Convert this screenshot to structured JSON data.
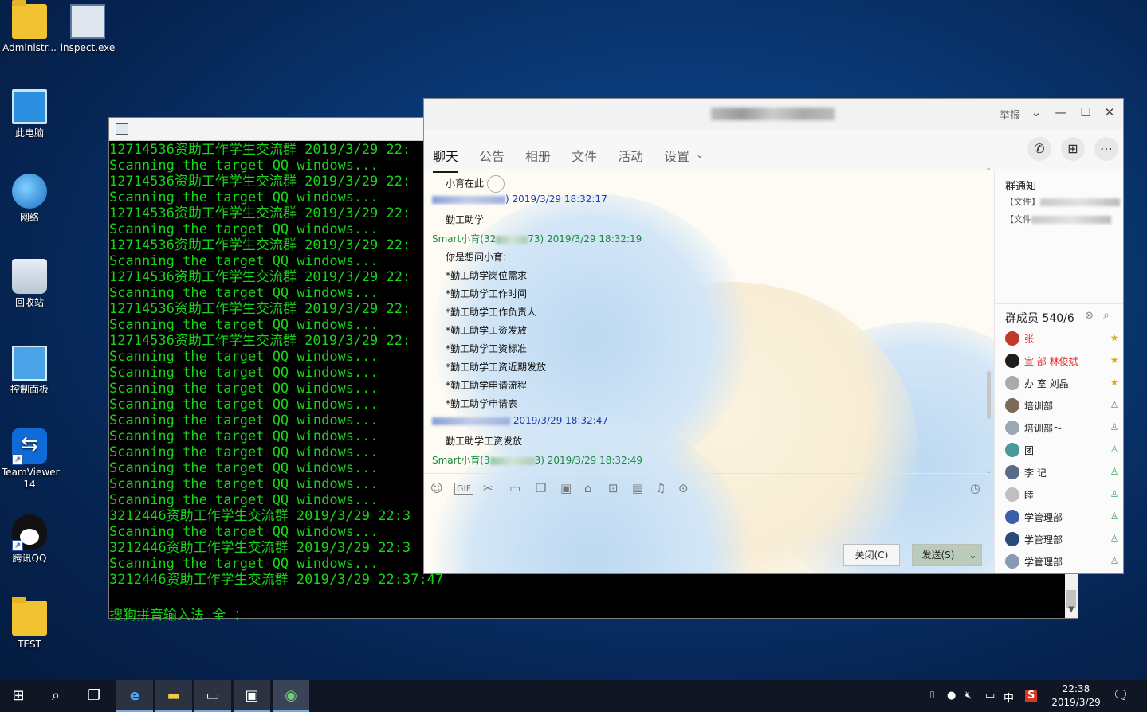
{
  "desktop": {
    "icons": [
      {
        "label": "Administr..."
      },
      {
        "label": "inspect.exe"
      },
      {
        "label": "此电脑"
      },
      {
        "label": "网络"
      },
      {
        "label": "回收站"
      },
      {
        "label": "控制面板"
      },
      {
        "label": "TeamViewer 14"
      },
      {
        "label": "腾讯QQ"
      },
      {
        "label": "TEST"
      }
    ]
  },
  "console": {
    "lines": [
      "12714536资助工作学生交流群 2019/3/29 22:",
      "Scanning the target QQ windows...",
      "12714536资助工作学生交流群 2019/3/29 22:",
      "Scanning the target QQ windows...",
      "12714536资助工作学生交流群 2019/3/29 22:",
      "Scanning the target QQ windows...",
      "12714536资助工作学生交流群 2019/3/29 22:",
      "Scanning the target QQ windows...",
      "12714536资助工作学生交流群 2019/3/29 22:",
      "Scanning the target QQ windows...",
      "12714536资助工作学生交流群 2019/3/29 22:",
      "Scanning the target QQ windows...",
      "12714536资助工作学生交流群 2019/3/29 22:",
      "Scanning the target QQ windows...",
      "Scanning the target QQ windows...",
      "Scanning the target QQ windows...",
      "Scanning the target QQ windows...",
      "Scanning the target QQ windows...",
      "Scanning the target QQ windows...",
      "Scanning the target QQ windows...",
      "Scanning the target QQ windows...",
      "Scanning the target QQ windows...",
      "Scanning the target QQ windows...",
      "3212446资助工作学生交流群 2019/3/29 22:3",
      "Scanning the target QQ windows...",
      "3212446资助工作学生交流群 2019/3/29 22:3",
      "Scanning the target QQ windows...",
      "3212446资助工作学生交流群 2019/3/29 22:37:47"
    ],
    "ime_status": "搜狗拼音输入法 全 ："
  },
  "qq": {
    "report": "举报",
    "tabs": [
      "聊天",
      "公告",
      "相册",
      "文件",
      "活动",
      "设置"
    ],
    "messages": [
      {
        "kind": "text",
        "text": "小育在此"
      },
      {
        "kind": "meta",
        "color": "blue",
        "prefix": "",
        "suffix": ") 2019/3/29 18:32:17"
      },
      {
        "kind": "text",
        "text": "勤工助学"
      },
      {
        "kind": "meta",
        "color": "green",
        "prefix": "Smart小育(32",
        "suffix": "73) 2019/3/29 18:32:19"
      },
      {
        "kind": "text",
        "text": "你是想问小育:"
      },
      {
        "kind": "text",
        "text": "*勤工助学岗位需求"
      },
      {
        "kind": "text",
        "text": "*勤工助学工作时间"
      },
      {
        "kind": "text",
        "text": "*勤工助学工作负责人"
      },
      {
        "kind": "text",
        "text": "*勤工助学工资发放"
      },
      {
        "kind": "text",
        "text": "*勤工助学工资标准"
      },
      {
        "kind": "text",
        "text": "*勤工助学工资近期发放"
      },
      {
        "kind": "text",
        "text": "*勤工助学申请流程"
      },
      {
        "kind": "text",
        "text": "*勤工助学申请表"
      },
      {
        "kind": "meta",
        "color": "blue",
        "prefix": "",
        "suffix": " 2019/3/29 18:32:47"
      },
      {
        "kind": "text",
        "text": "勤工助学工资发放"
      },
      {
        "kind": "meta",
        "color": "green",
        "prefix": "Smart小育(3",
        "suffix": "3) 2019/3/29 18:32:49"
      }
    ],
    "buttons": {
      "close": "关闭(C)",
      "send": "发送(S)"
    },
    "notice_title": "群通知",
    "notices": [
      "【文件】",
      "【文件"
    ],
    "members_title": "群成员 540/6",
    "members": [
      {
        "name": "张",
        "color": "#e02b2b"
      },
      {
        "name": "宣    部 林俊斌",
        "color": "#e02b2b"
      },
      {
        "name": "办   室 刘晶",
        "color": "#222222"
      },
      {
        "name": "培训部",
        "color": "#222222"
      },
      {
        "name": "培训部～",
        "color": "#222222"
      },
      {
        "name": "团",
        "color": "#222222"
      },
      {
        "name": "李   记",
        "color": "#222222"
      },
      {
        "name": "睦",
        "color": "#222222"
      },
      {
        "name": "学管理部",
        "color": "#222222"
      },
      {
        "name": "学管理部",
        "color": "#222222"
      },
      {
        "name": "学管理部",
        "color": "#222222"
      }
    ]
  },
  "taskbar": {
    "ime_lang": "中",
    "clock_time": "22:38",
    "clock_date": "2019/3/29"
  }
}
